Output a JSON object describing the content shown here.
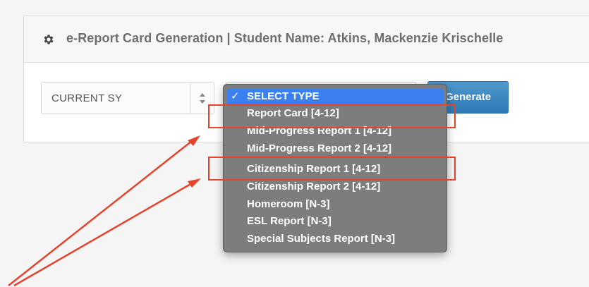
{
  "header": {
    "title": "e-Report Card Generation | Student Name: Atkins, Mackenzie Krischelle",
    "icon": "gear-icon"
  },
  "school_year_select": {
    "selected": "CURRENT SY",
    "icon": "up-down-stepper-icon"
  },
  "generate_button": {
    "label": "Generate"
  },
  "report_type_dropdown": {
    "options": [
      {
        "label": "SELECT TYPE",
        "selected": true
      },
      {
        "label": "Report Card [4-12]",
        "selected": false
      },
      {
        "label": "Mid-Progress Report 1 [4-12]",
        "selected": false
      },
      {
        "label": "Mid-Progress Report 2 [4-12]",
        "selected": false
      },
      {
        "label": "Citizenship Report 1 [4-12]",
        "selected": false
      },
      {
        "label": "Citizenship Report 2 [4-12]",
        "selected": false
      },
      {
        "label": "Homeroom [N-3]",
        "selected": false
      },
      {
        "label": "ESL Report [N-3]",
        "selected": false
      },
      {
        "label": "Special Subjects Report [N-3]",
        "selected": false
      }
    ],
    "check_mark": "✓"
  },
  "colors": {
    "highlight": "#e4432c",
    "selected_bg": "#3b7ff1",
    "button": "#3a86c1",
    "menu_bg": "#7d7d7d"
  }
}
